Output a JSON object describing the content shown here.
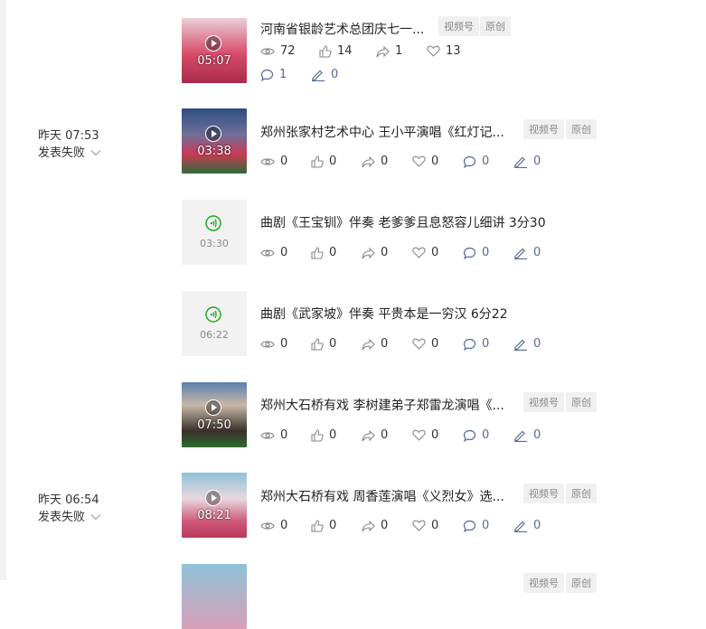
{
  "rows": [
    {
      "time": "",
      "status": "",
      "duration": "05:07",
      "kind": "video",
      "title": "河南省银龄艺术总团庆七一...",
      "tags": [
        "视频号",
        "原创"
      ],
      "stats": {
        "views": "72",
        "likes": "14",
        "shares": "1",
        "favs": "13",
        "comments": "1",
        "edits": "0"
      }
    },
    {
      "time": "昨天 07:53",
      "status": "发表失败",
      "duration": "03:38",
      "kind": "video",
      "title": "郑州张家村艺术中心 王小平演唱《红灯记...",
      "tags": [
        "视频号",
        "原创"
      ],
      "stats": {
        "views": "0",
        "likes": "0",
        "shares": "0",
        "favs": "0",
        "comments": "0",
        "edits": "0"
      }
    },
    {
      "time": "",
      "status": "",
      "duration": "03:30",
      "kind": "audio",
      "title": "曲剧《王宝钏》伴奏 老爹爹且息怒容儿细讲 3分30",
      "tags": [],
      "stats": {
        "views": "0",
        "likes": "0",
        "shares": "0",
        "favs": "0",
        "comments": "0",
        "edits": "0"
      }
    },
    {
      "time": "",
      "status": "",
      "duration": "06:22",
      "kind": "audio",
      "title": "曲剧《武家坡》伴奏 平贵本是一穷汉 6分22",
      "tags": [],
      "stats": {
        "views": "0",
        "likes": "0",
        "shares": "0",
        "favs": "0",
        "comments": "0",
        "edits": "0"
      }
    },
    {
      "time": "",
      "status": "",
      "duration": "07:50",
      "kind": "video",
      "title": "郑州大石桥有戏 李树建弟子郑雷龙演唱《...",
      "tags": [
        "视频号",
        "原创"
      ],
      "stats": {
        "views": "0",
        "likes": "0",
        "shares": "0",
        "favs": "0",
        "comments": "0",
        "edits": "0"
      }
    },
    {
      "time": "昨天 06:54",
      "status": "发表失败",
      "duration": "08:21",
      "kind": "video",
      "title": "郑州大石桥有戏 周香莲演唱《义烈女》选...",
      "tags": [
        "视频号",
        "原创"
      ],
      "stats": {
        "views": "0",
        "likes": "0",
        "shares": "0",
        "favs": "0",
        "comments": "0",
        "edits": "0"
      }
    }
  ],
  "partial_row": {
    "tags": [
      "视频号",
      "原创"
    ]
  },
  "colors": {
    "accent_blue": "#576b95",
    "audio_green": "#1aad19",
    "tag_bg": "#f0f0f0"
  }
}
